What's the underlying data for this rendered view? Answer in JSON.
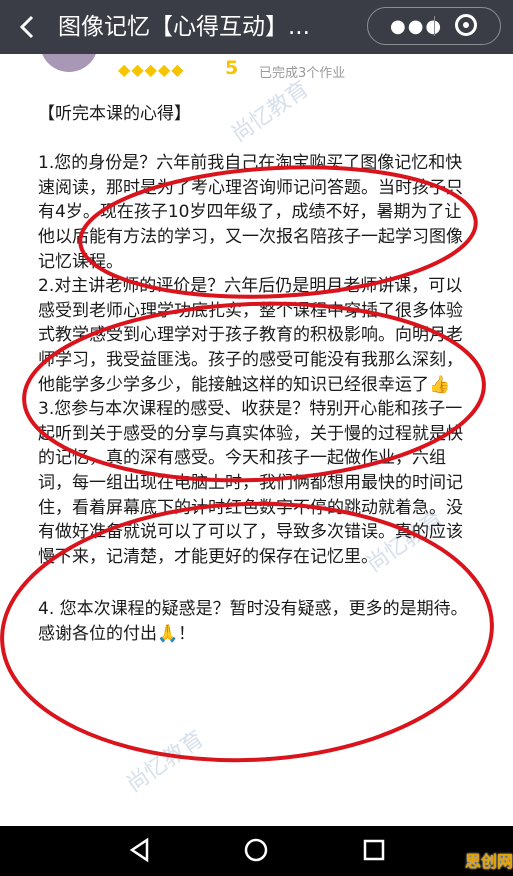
{
  "header": {
    "back_icon": "chevron-left-icon",
    "title": "图像记忆【心得互动】...",
    "more_icon": "more-dots-icon",
    "close_icon": "close-circle-icon"
  },
  "profile": {
    "rating_stars": 5,
    "score": "5",
    "status": "已完成3个作业"
  },
  "watermark": "尚忆教育",
  "post": {
    "heading": "【听完本课的心得】",
    "paragraphs": [
      "1.您的身份是？六年前我自己在淘宝购买了图像记忆和快速阅读，那时是为了考心理咨询师记问答题。当时孩子只有4岁。现在孩子10岁四年级了，成绩不好，暑期为了让他以后能有方法的学习，又一次报名陪孩子一起学习图像记忆课程。",
      "2.对主讲老师的评价是？六年后仍是明月老师讲课，可以感受到老师心理学功底扎实，整个课程中穿插了很多体验式教学感受到心理学对于孩子教育的积极影响。向明月老师学习，我受益匪浅。孩子的感受可能没有我那么深刻，他能学多少学多少，能接触这样的知识已经很幸运了👍",
      "3.您参与本次课程的感受、收获是？特别开心能和孩子一起听到关于感受的分享与真实体验，关于慢的过程就是快的记忆，真的深有感受。今天和孩子一起做作业，六组词，每一组出现在电脑上时，我们俩都想用最快的时间记住，看着屏幕底下的计时红色数字不停的跳动就着急。没有做好准备就说可以了可以了，导致多次错误。真的应该慢下来，记清楚，才能更好的保存在记忆里。",
      "4. 您本次课程的疑惑是？暂时没有疑惑，更多的是期待。感谢各位的付出🙏！"
    ]
  },
  "navbar": {
    "back_icon": "triangle-back-icon",
    "home_icon": "circle-home-icon",
    "recent_icon": "square-recent-icon"
  },
  "corner_logo": "思创网",
  "colors": {
    "topbar": "#3a3d45",
    "annotation_red": "#d9141c",
    "star": "#f6c400"
  }
}
